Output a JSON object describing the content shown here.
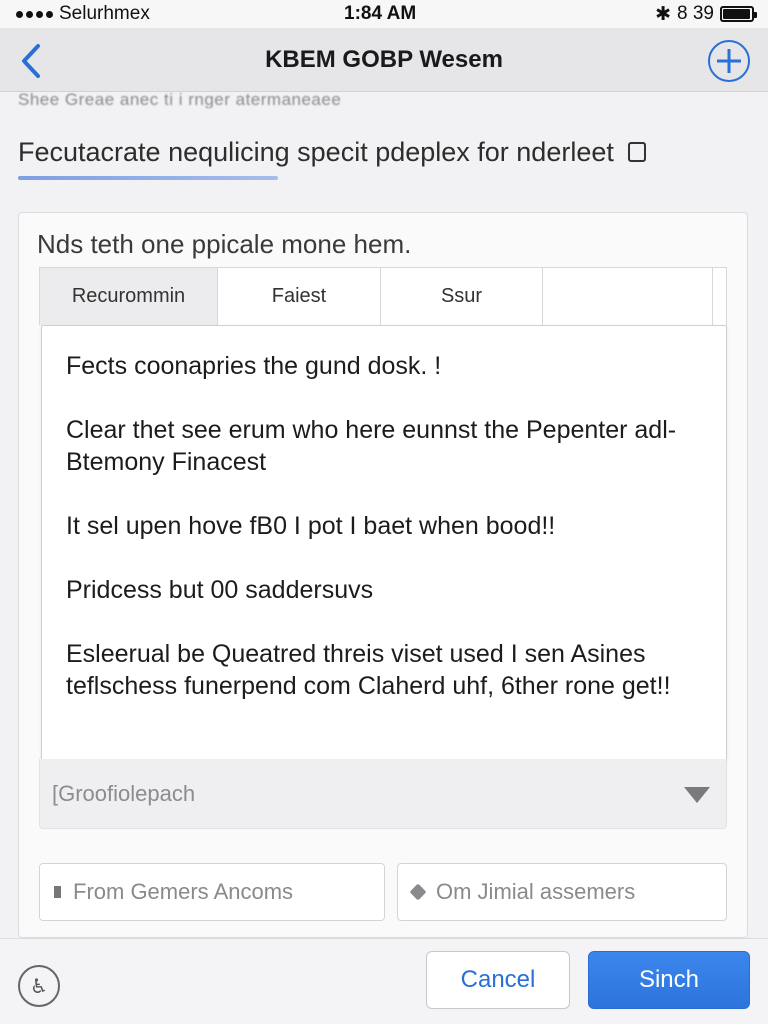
{
  "status_bar": {
    "carrier": "Selurhmex",
    "time": "1:84 AM",
    "battery_text": "8 39",
    "battery_icon": "battery-icon",
    "battery_level": 0.95
  },
  "nav": {
    "back_icon": "chevron-left-icon",
    "title": "KBEM GOBP Wesem",
    "add_icon": "plus-circle-icon"
  },
  "subheader": "Shee Greae anec ti i rnger atermaneaee",
  "prompt": {
    "text": "Fecutacrate nequlicing specit pdeplex for nderleet",
    "icon": "document-icon"
  },
  "card": {
    "title": "Nds teth one ppicale mone hem.",
    "tabs": [
      {
        "label": "Recurommin"
      },
      {
        "label": "Faiest"
      },
      {
        "label": "Ssur"
      },
      {
        "label": ""
      }
    ],
    "paragraphs": [
      "Fects coonapries the gund dosk. !",
      "Clear thet see erum who here eunnst the Pepenter adl- Btemony Finacest",
      "It sel upen hove fB0 I pot I baet when bood!!",
      "Pridcess but 00 saddersuvs",
      "Esleerual be Queatred threis viset used I sen Asines teflschess funerpend com Claherd uhf, 6ther rone get!!"
    ],
    "dropdown": {
      "value": "[Groofiolepach",
      "icon": "chevron-down-icon"
    },
    "options": [
      {
        "label": "From Gemers Ancoms",
        "icon": "bar-icon"
      },
      {
        "label": "Om Jimial assemers",
        "icon": "diamond-icon"
      }
    ]
  },
  "bottom_bar": {
    "info_icon": "accessibility-icon",
    "cancel_label": "Cancel",
    "primary_label": "Sinch"
  },
  "colors": {
    "accent": "#2a6fd6",
    "primary_button": "#3580e6"
  }
}
